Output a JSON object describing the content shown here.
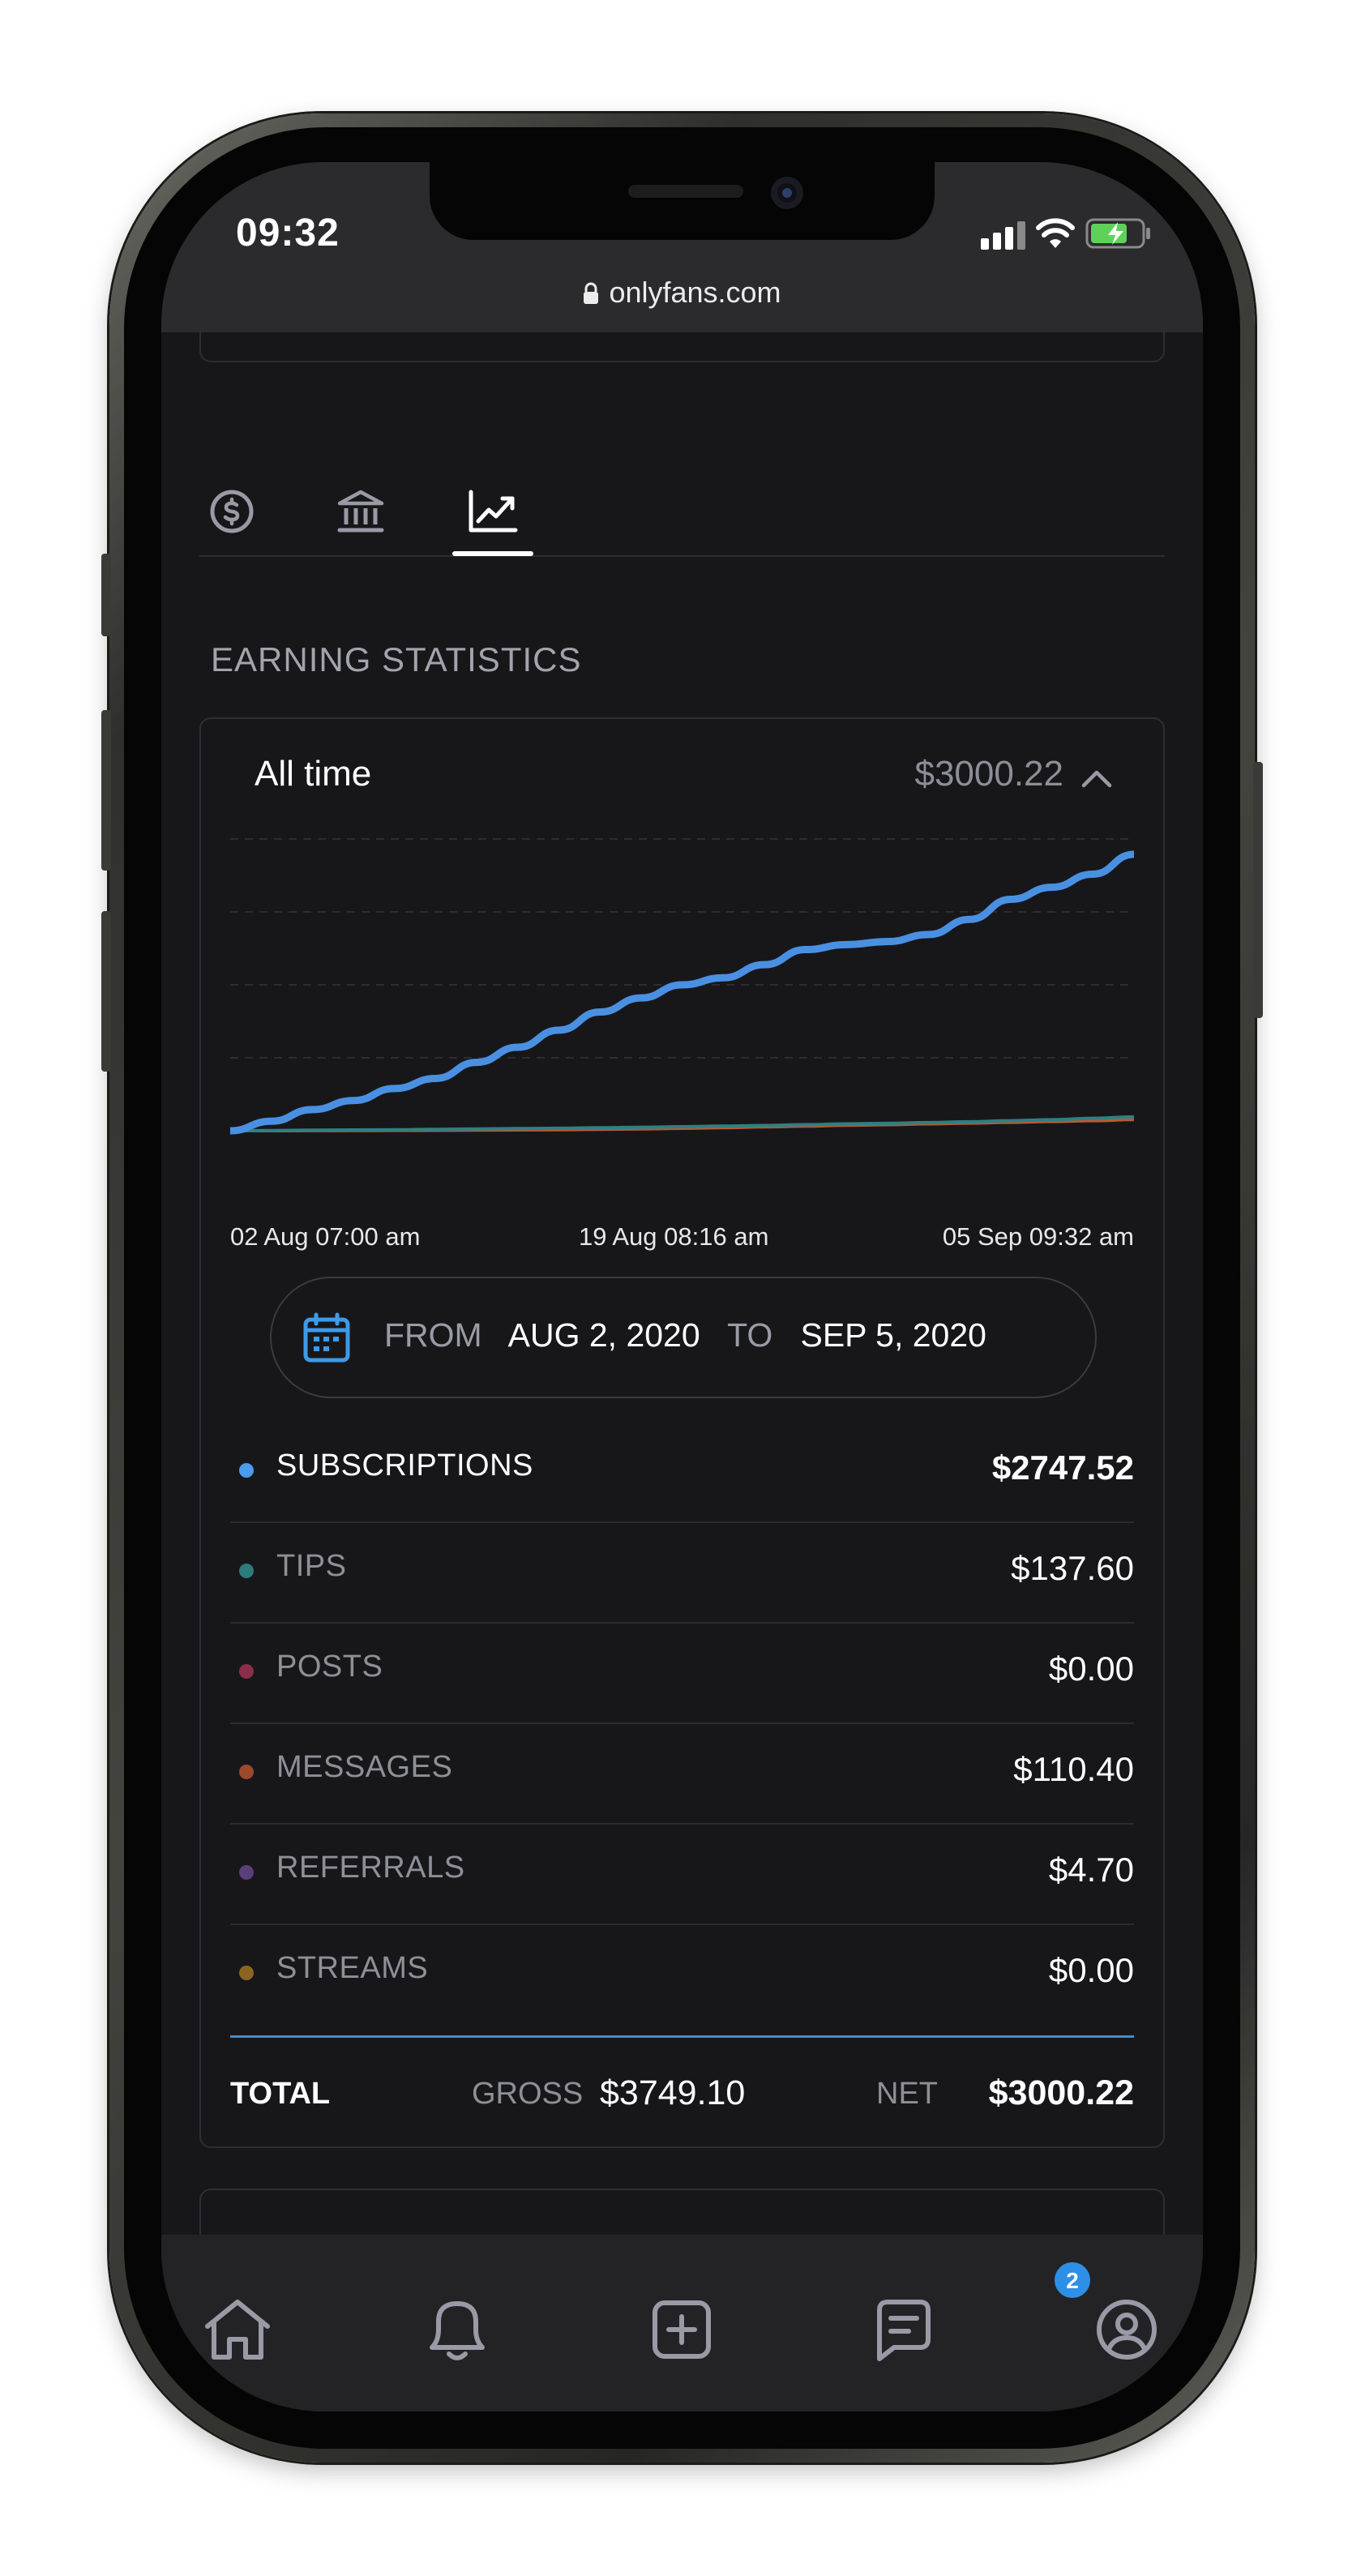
{
  "status_bar": {
    "time": "09:32"
  },
  "browser": {
    "url": "onlyfans.com"
  },
  "tabs": [
    {
      "icon": "dollar-circle-icon",
      "active": false
    },
    {
      "icon": "bank-icon",
      "active": false
    },
    {
      "icon": "chart-line-icon",
      "active": true
    }
  ],
  "section_title": "EARNING STATISTICS",
  "card": {
    "period": "All time",
    "period_total": "$3000.22",
    "collapse_icon": "chevron-up-icon"
  },
  "chart_data": {
    "type": "line",
    "x_labels": [
      "02 Aug 07:00 am",
      "19 Aug 08:16 am",
      "05 Sep 09:32 am"
    ],
    "grid": "horizontal-dashed",
    "series": [
      {
        "color": "#4a90e2",
        "values": [
          0,
          95,
          210,
          300,
          420,
          520,
          680,
          830,
          1000,
          1180,
          1320,
          1450,
          1520,
          1650,
          1800,
          1850,
          1880,
          1950,
          2100,
          2300,
          2420,
          2550,
          2747.52
        ]
      },
      {
        "color": "#2f7f82",
        "values": [
          0,
          2,
          6,
          8,
          10,
          14,
          18,
          22,
          25,
          30,
          34,
          40,
          46,
          52,
          60,
          68,
          74,
          82,
          90,
          100,
          110,
          124,
          137.6
        ]
      },
      {
        "color": "#b65a35",
        "values": [
          0,
          0,
          1,
          2,
          3,
          4,
          6,
          8,
          10,
          14,
          18,
          24,
          30,
          38,
          46,
          54,
          60,
          68,
          76,
          84,
          92,
          100,
          110.4
        ]
      }
    ]
  },
  "date_range": {
    "icon": "calendar-icon",
    "from_label": "FROM",
    "from_value": "AUG 2, 2020",
    "to_label": "TO",
    "to_value": "SEP 5, 2020"
  },
  "breakdown": [
    {
      "label": "SUBSCRIPTIONS",
      "value": "$2747.52",
      "color": "#4a9cf0"
    },
    {
      "label": "TIPS",
      "value": "$137.60",
      "color": "#2d7b7b"
    },
    {
      "label": "POSTS",
      "value": "$0.00",
      "color": "#8a2f4a"
    },
    {
      "label": "MESSAGES",
      "value": "$110.40",
      "color": "#9a4a2c"
    },
    {
      "label": "REFERRALS",
      "value": "$4.70",
      "color": "#5a3f7a"
    },
    {
      "label": "STREAMS",
      "value": "$0.00",
      "color": "#8a6420"
    }
  ],
  "totals": {
    "label": "TOTAL",
    "gross_label": "GROSS",
    "gross_value": "$3749.10",
    "net_label": "NET",
    "net_value": "$3000.22"
  },
  "bottom_nav": {
    "items": [
      "home-icon",
      "bell-icon",
      "plus-square-icon",
      "messages-icon",
      "profile-icon"
    ],
    "messages_badge": "2"
  }
}
